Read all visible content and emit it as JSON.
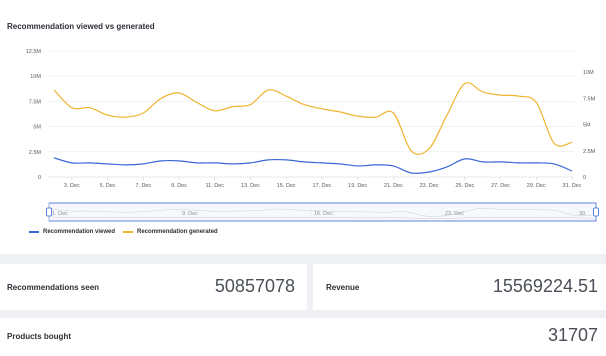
{
  "chart": {
    "title": "Recommendation viewed vs generated",
    "legend": [
      {
        "label": "Recommendation viewed",
        "color": "#3a66d6"
      },
      {
        "label": "Recommendation generated",
        "color": "#f0b430"
      }
    ],
    "navigator_labels": [
      "1. Dec",
      "9. Dec",
      "16. Dec",
      "23. Dec",
      "30."
    ]
  },
  "chart_data": {
    "type": "line",
    "x": [
      "2. Dec",
      "3. Dec",
      "4. Dec",
      "5. Dec",
      "6. Dec",
      "7. Dec",
      "8. Dec",
      "9. Dec",
      "10. Dec",
      "11. Dec",
      "12. Dec",
      "13. Dec",
      "14. Dec",
      "15. Dec",
      "16. Dec",
      "17. Dec",
      "18. Dec",
      "19. Dec",
      "20. Dec",
      "21. Dec",
      "22. Dec",
      "23. Dec",
      "24. Dec",
      "25. Dec",
      "26. Dec",
      "27. Dec",
      "28. Dec",
      "29. Dec",
      "30. Dec",
      "31. Dec"
    ],
    "x_tick_labels": [
      "3. Dec",
      "5. Dec",
      "7. Dec",
      "9. Dec",
      "11. Dec",
      "13. Dec",
      "15. Dec",
      "17. Dec",
      "19. Dec",
      "21. Dec",
      "23. Dec",
      "25. Dec",
      "27. Dec",
      "29. Dec",
      "31. Dec"
    ],
    "y_left_ticks": [
      "0",
      "2.5M",
      "5M",
      "7.5M",
      "10M",
      "12.5M"
    ],
    "y_right_ticks": [
      "0",
      "2.5M",
      "5M",
      "7.5M",
      "10M"
    ],
    "ylim_left": [
      0,
      12500000
    ],
    "ylim_right": [
      0,
      10000000
    ],
    "series": [
      {
        "name": "Recommendation viewed",
        "axis": "left",
        "values": [
          1900000,
          1400000,
          1400000,
          1300000,
          1200000,
          1300000,
          1600000,
          1600000,
          1400000,
          1400000,
          1300000,
          1400000,
          1700000,
          1700000,
          1500000,
          1400000,
          1300000,
          1100000,
          1200000,
          1100000,
          400000,
          500000,
          1000000,
          1800000,
          1500000,
          1500000,
          1400000,
          1400000,
          1300000,
          600000
        ]
      },
      {
        "name": "Recommendation generated",
        "axis": "right",
        "values": [
          8300000,
          6600000,
          6600000,
          5900000,
          5700000,
          6100000,
          7500000,
          8000000,
          7100000,
          6300000,
          6700000,
          6900000,
          8300000,
          7700000,
          6900000,
          6500000,
          6200000,
          5800000,
          5700000,
          6100000,
          2500000,
          2700000,
          5900000,
          8900000,
          8100000,
          7800000,
          7700000,
          7100000,
          3200000,
          3300000
        ]
      }
    ]
  },
  "metrics": {
    "seen": {
      "label": "Recommendations seen",
      "value": "50857078"
    },
    "revenue": {
      "label": "Revenue",
      "value": "15569224.51"
    },
    "bought": {
      "label": "Products bought",
      "value": "31707"
    }
  }
}
